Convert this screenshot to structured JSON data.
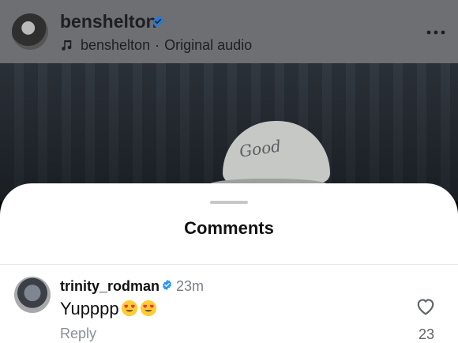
{
  "post": {
    "username": "benshelton",
    "audio_user": "benshelton",
    "separator": "·",
    "audio_label": "Original audio"
  },
  "video": {
    "cap_text": "Good"
  },
  "comments_sheet": {
    "title": "Comments",
    "comment": {
      "username": "trinity_rodman",
      "time": "23m",
      "text": "Yupppp",
      "reply_label": "Reply",
      "like_count": "23"
    }
  },
  "colors": {
    "verified": "#2e93ff",
    "emoji_face": "#ffcc33",
    "heart_eyes": "#e8334a"
  },
  "icons": {
    "verified": "verified-badge-icon",
    "music": "music-note-icon",
    "more": "more-horizontal-icon",
    "heart": "heart-outline-icon",
    "emoji": "heart-eyes-emoji-icon"
  }
}
